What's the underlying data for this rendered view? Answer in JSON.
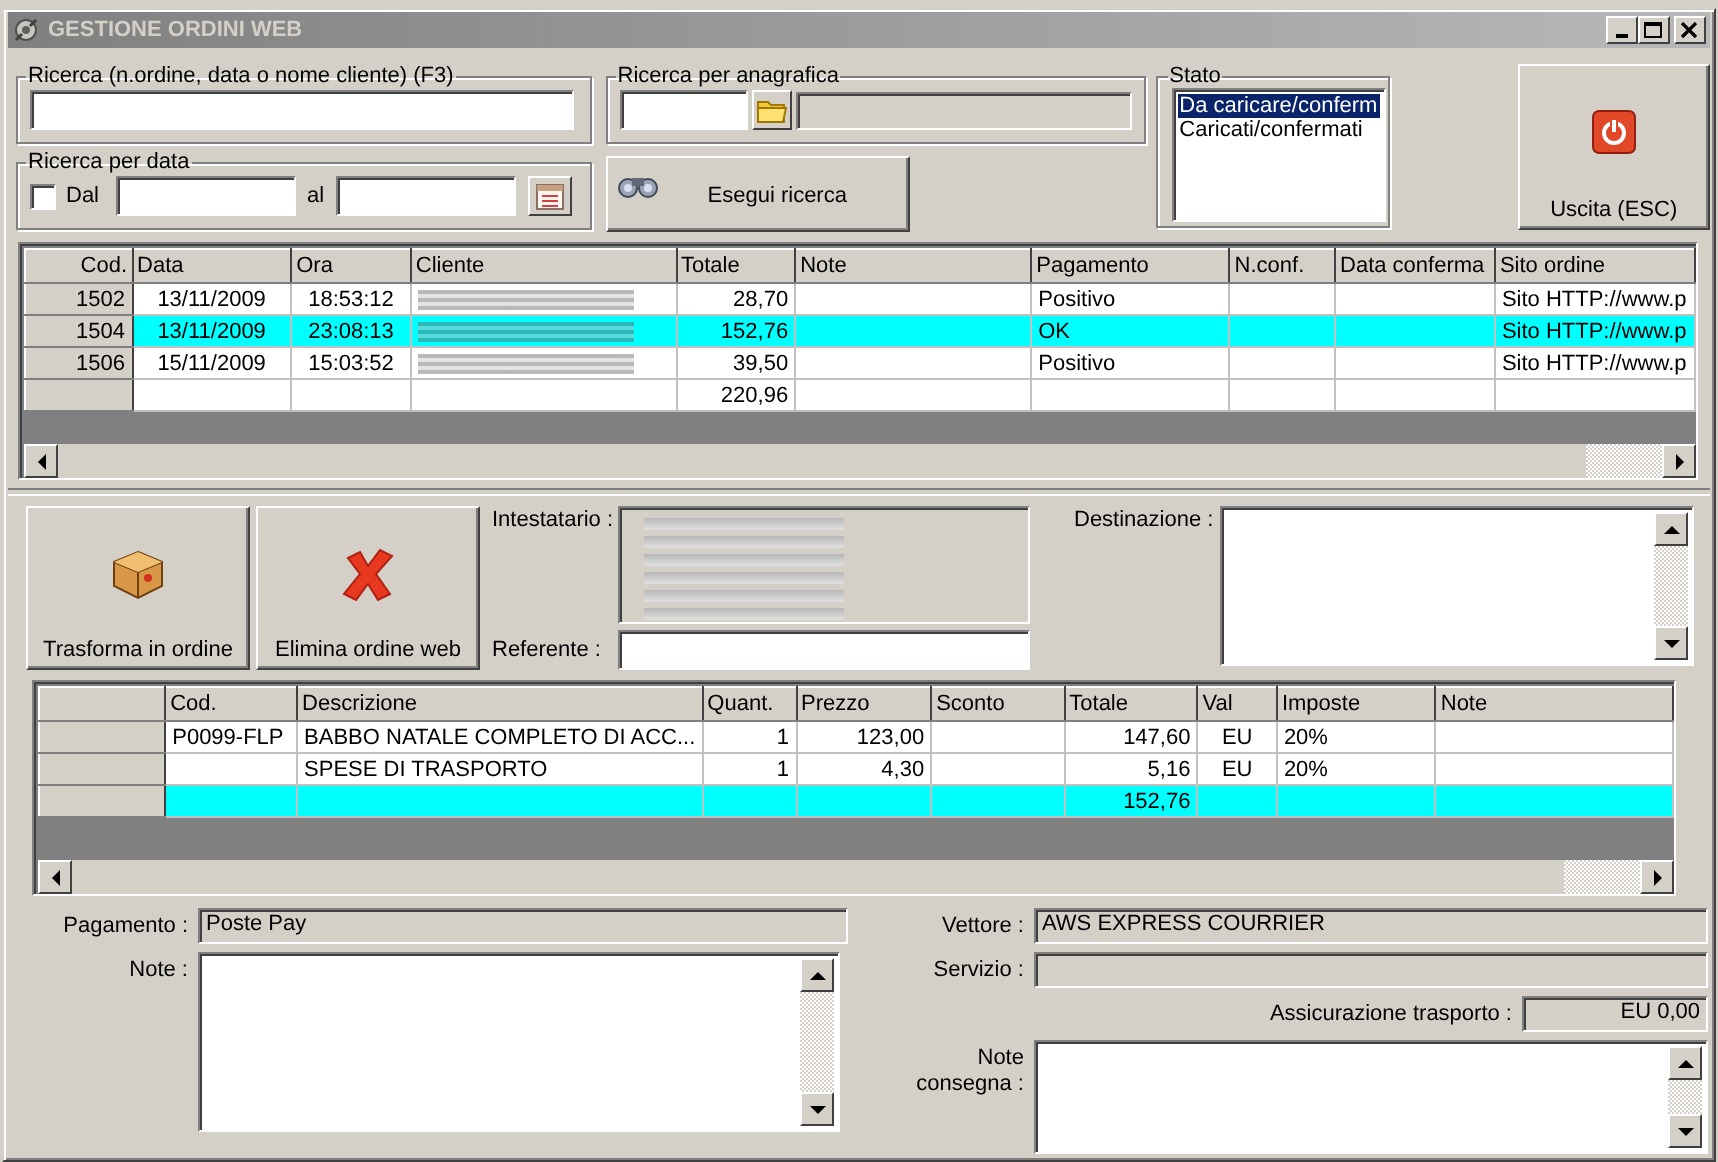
{
  "window": {
    "title": "GESTIONE ORDINI WEB"
  },
  "text_search": {
    "label": "Ricerca (n.ordine, data o nome cliente) (F3)"
  },
  "registry_search": {
    "label": "Ricerca per anagrafica"
  },
  "date_search": {
    "label": "Ricerca per data",
    "checked": false,
    "from_label": "Dal",
    "to_label": "al"
  },
  "search_button": {
    "label": "Esegui ricerca"
  },
  "status": {
    "label": "Stato",
    "options": [
      {
        "label": "Da caricare/conferm",
        "selected": true
      },
      {
        "label": "Caricati/confermati",
        "selected": false
      }
    ]
  },
  "exit_button": {
    "label": "Uscita (ESC)"
  },
  "orders": {
    "columns": [
      {
        "label": "Cod.",
        "kind": "number"
      },
      {
        "label": "Data",
        "kind": "centered"
      },
      {
        "label": "Ora",
        "kind": "centered"
      },
      {
        "label": "Cliente",
        "kind": "redacted"
      },
      {
        "label": "Totale",
        "kind": "number"
      },
      {
        "label": "Note",
        "kind": "text"
      },
      {
        "label": "Pagamento",
        "kind": "text"
      },
      {
        "label": "N.conf.",
        "kind": "text"
      },
      {
        "label": "Data conferma",
        "kind": "text"
      },
      {
        "label": "Sito ordine",
        "kind": "text"
      }
    ],
    "rows": [
      {
        "selected": false,
        "client_redacted": true,
        "cells": [
          "1502",
          "13/11/2009",
          "18:53:12",
          null,
          "28,70",
          null,
          "Positivo",
          null,
          null,
          "Sito HTTP://www.p"
        ]
      },
      {
        "selected": true,
        "client_redacted": true,
        "cells": [
          "1504",
          "13/11/2009",
          "23:08:13",
          null,
          "152,76",
          null,
          "OK",
          null,
          null,
          "Sito HTTP://www.p"
        ]
      },
      {
        "selected": false,
        "client_redacted": true,
        "cells": [
          "1506",
          "15/11/2009",
          "15:03:52",
          null,
          "39,50",
          null,
          "Positivo",
          null,
          null,
          "Sito HTTP://www.p"
        ]
      },
      {
        "selected": false,
        "client_redacted": false,
        "cells": [
          null,
          null,
          null,
          null,
          "220,96",
          null,
          null,
          null,
          null,
          null
        ]
      }
    ]
  },
  "actions": [
    {
      "label": "Trasforma in ordine",
      "kind": "convert"
    },
    {
      "label": "Elimina ordine web",
      "kind": "delete"
    }
  ],
  "holder": {
    "label": "Intestatario :"
  },
  "contact": {
    "label": "Referente :"
  },
  "destination": {
    "label": "Destinazione :"
  },
  "items": {
    "columns": [
      {
        "kind": "selector"
      },
      {
        "label": "Cod.",
        "kind": "text"
      },
      {
        "label": "Descrizione",
        "kind": "text"
      },
      {
        "label": "Quant.",
        "kind": "number"
      },
      {
        "label": "Prezzo",
        "kind": "number"
      },
      {
        "label": "Sconto",
        "kind": "number"
      },
      {
        "label": "Totale",
        "kind": "number"
      },
      {
        "label": "Val",
        "kind": "centered"
      },
      {
        "label": "Imposte",
        "kind": "text"
      },
      {
        "label": "Note",
        "kind": "text"
      }
    ],
    "rows": [
      {
        "selected": false,
        "cells": [
          null,
          "P0099-FLP",
          "BABBO NATALE COMPLETO DI ACC...",
          "1",
          "123,00",
          null,
          "147,60",
          "EU",
          "20%",
          null
        ]
      },
      {
        "selected": false,
        "cells": [
          null,
          null,
          "SPESE DI TRASPORTO",
          "1",
          "4,30",
          null,
          "5,16",
          "EU",
          "20%",
          null
        ]
      },
      {
        "selected": true,
        "cells": [
          null,
          null,
          null,
          null,
          null,
          null,
          "152,76",
          null,
          null,
          null
        ]
      }
    ]
  },
  "payment": {
    "label": "Pagamento :",
    "value": "Poste Pay"
  },
  "notes": {
    "label": "Note :"
  },
  "carrier": {
    "label": "Vettore :",
    "value": "AWS EXPRESS COURRIER"
  },
  "service": {
    "label": "Servizio :"
  },
  "insurance": {
    "label": "Assicurazione trasporto :",
    "value": "EU 0,00"
  },
  "delivery_notes": {
    "label": "Note consegna :"
  }
}
